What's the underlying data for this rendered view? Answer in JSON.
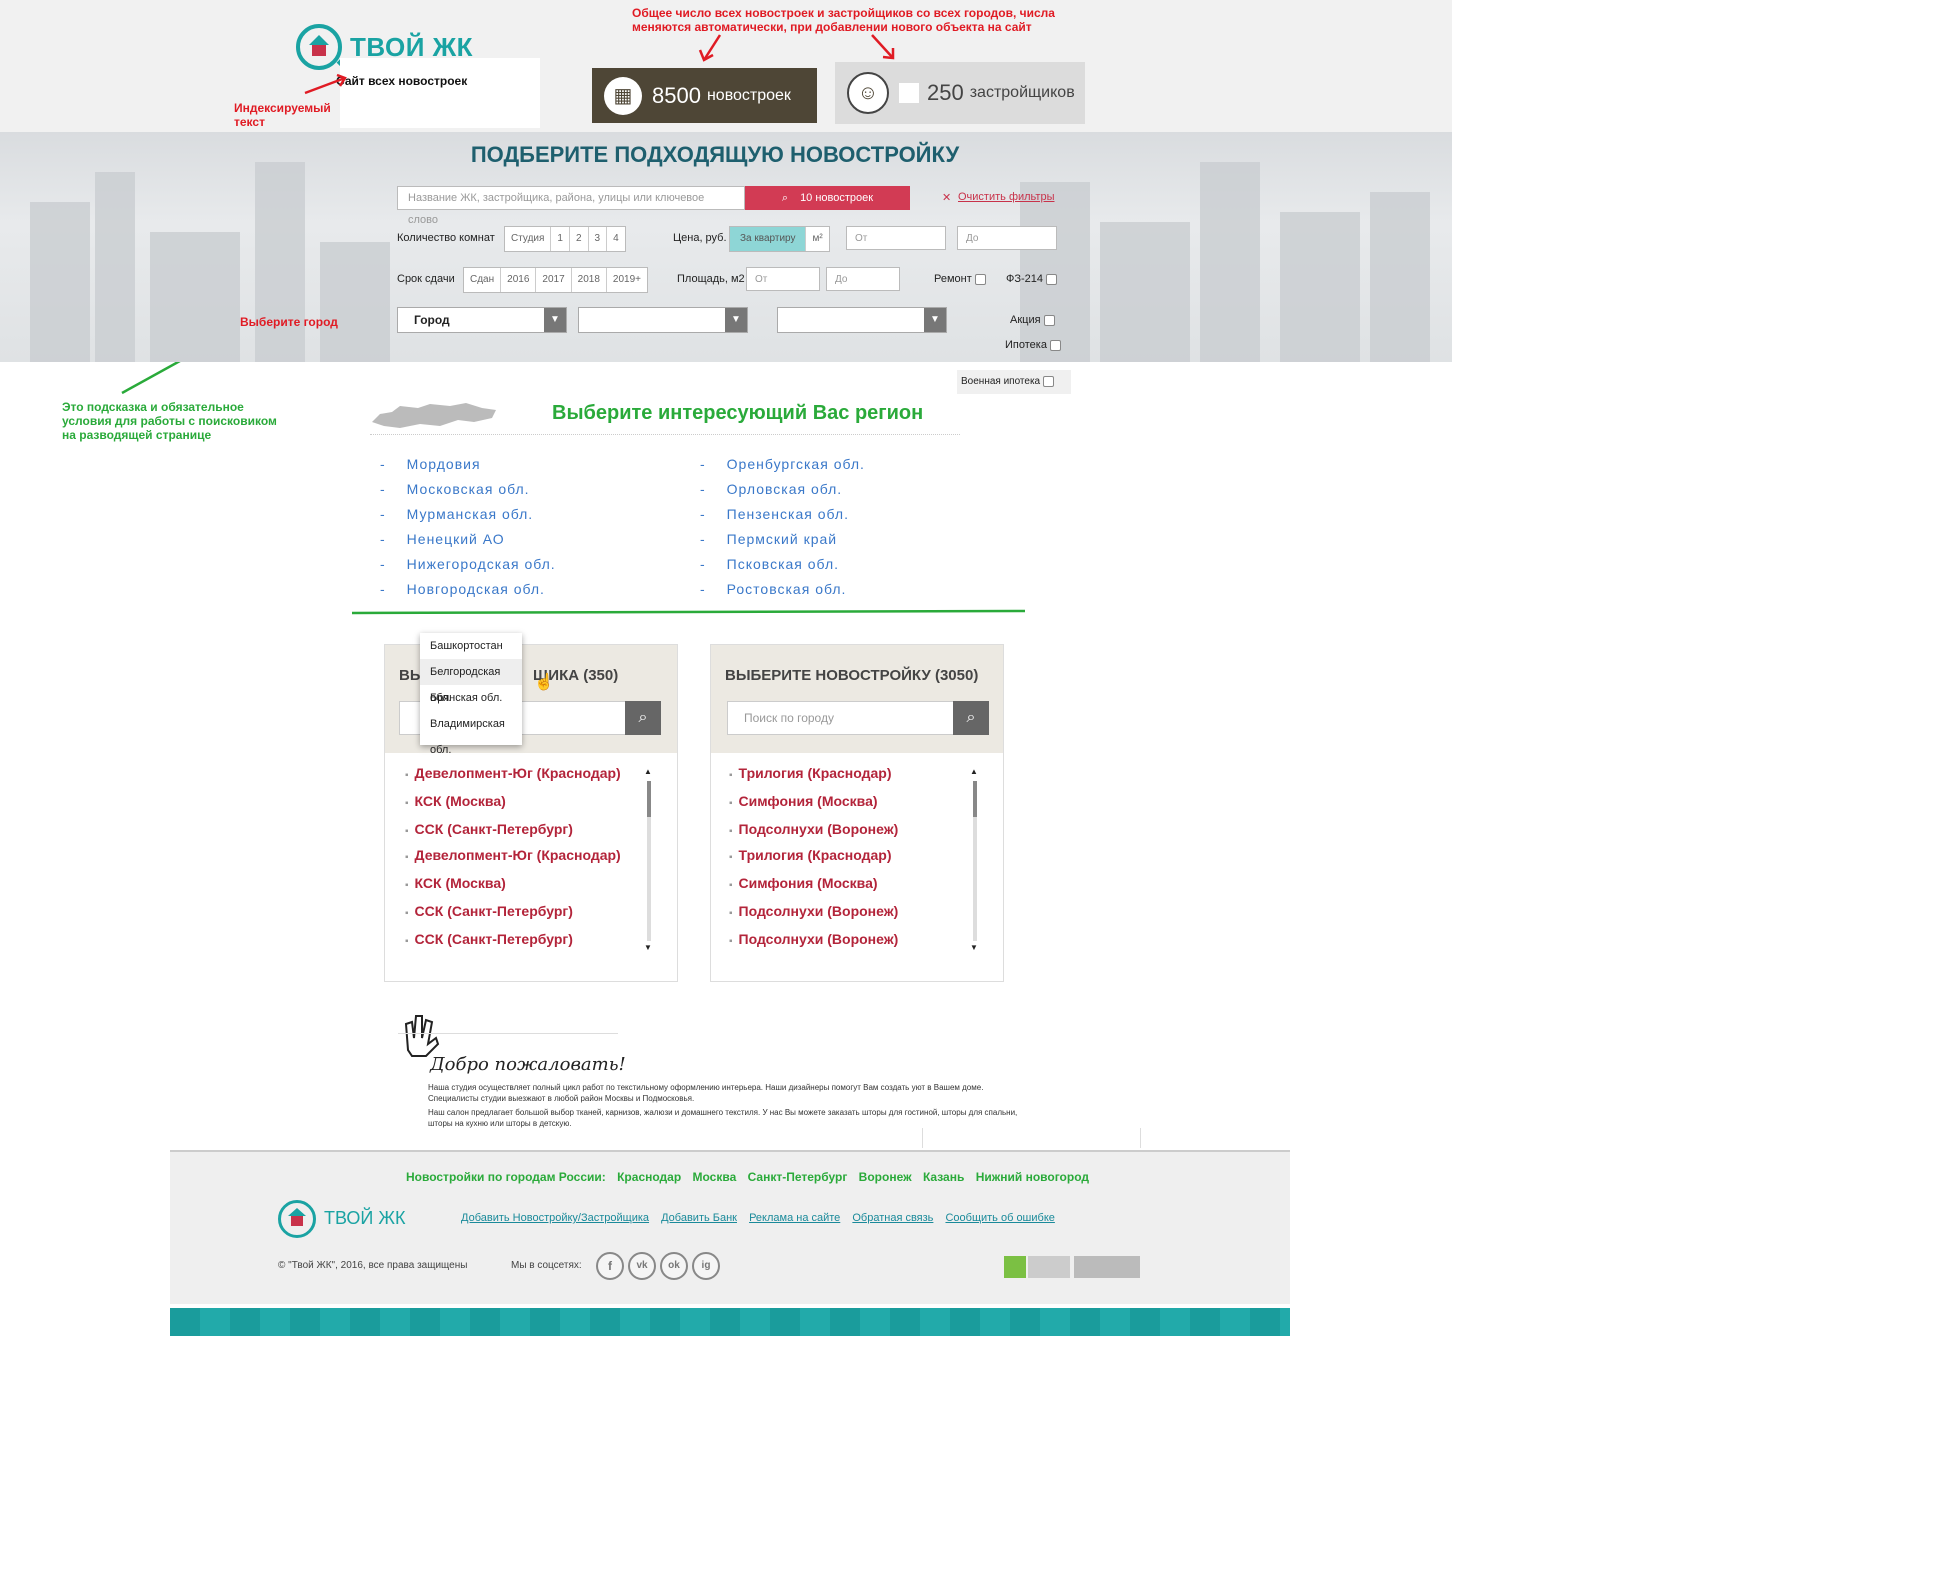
{
  "header": {
    "logo_text": "ТВОЙ ЖК",
    "tagline": "Сайт всех новостроек",
    "stats": [
      {
        "number": "8500",
        "label": "новостроек"
      },
      {
        "number": "250",
        "label": "застройщиков"
      }
    ]
  },
  "annotations": {
    "top_note": "Общее число всех новостроек и застройщиков со всех городов, числа меняются автоматически, при добавлении нового объекта на сайт",
    "indexed_text": "Индексируемый текст",
    "choose_city": "Выберите город",
    "hint": "Это подсказка и обязательное условия для работы с поисковиком на разводящей странице"
  },
  "filters": {
    "title": "ПОДБЕРИТЕ ПОДХОДЯЩУЮ НОВОСТРОЙКУ",
    "search_placeholder": "Название ЖК, застройщика, района, улицы или ключевое слово",
    "search_button": "10 новостроек",
    "clear": "Очистить фильтры",
    "rooms_label": "Количество комнат",
    "rooms": [
      "Студия",
      "1",
      "2",
      "3",
      "4"
    ],
    "price_label": "Цена, руб.",
    "price_modes": [
      "За квартиру",
      "м²"
    ],
    "from": "От",
    "to": "До",
    "deadline_label": "Срок сдачи",
    "deadlines": [
      "Сдан",
      "2016",
      "2017",
      "2018",
      "2019+"
    ],
    "area_label": "Площадь, м2",
    "repair": "Ремонт",
    "fz": "ФЗ-214",
    "action": "Акция",
    "mortgage": "Ипотека",
    "military": "Военная ипотека",
    "city_select": "Город"
  },
  "regions": {
    "title": "Выберите интересующий Вас регион",
    "left": [
      "Мордовия",
      "Московская обл.",
      "Мурманская обл.",
      "Ненецкий АО",
      "Нижегородская обл.",
      "Новгородская обл."
    ],
    "right": [
      "Оренбургская обл.",
      "Орловская обл.",
      "Пензенская обл.",
      "Пермский край",
      "Псковская обл.",
      "Ростовская обл."
    ]
  },
  "developers_panel": {
    "title": "ВЫБЕРИТЕ ЗАСТРОЙЩИКА (350)",
    "title_visible": "ЩИКА (350)",
    "title_prefix": "ВЫ",
    "items": [
      "Девелопмент-Юг (Краснодар)",
      "КСК (Москва)",
      "ССК (Санкт-Петербург)",
      "Девелопмент-Юг (Краснодар)",
      "КСК (Москва)",
      "ССК (Санкт-Петербург)",
      "ССК (Санкт-Петербург)"
    ]
  },
  "dropdown": [
    "Башкортостан",
    "Белгородская обл.",
    "Брянская обл.",
    "Владимирская обл."
  ],
  "buildings_panel": {
    "title": "ВЫБЕРИТЕ НОВОСТРОЙКУ (3050)",
    "search_placeholder": "Поиск по городу",
    "items": [
      "Трилогия (Краснодар)",
      "Симфония (Москва)",
      "Подсолнухи (Воронеж)",
      "Трилогия (Краснодар)",
      "Симфония (Москва)",
      "Подсолнухи (Воронеж)",
      "Подсолнухи (Воронеж)"
    ]
  },
  "welcome": {
    "title": "Добро пожаловать!",
    "p1": "Наша студия осуществляет полный цикл работ по текстильному оформлению интерьера. Наши дизайнеры помогут Вам создать уют в Вашем доме.",
    "p2": "Специалисты студии выезжают в любой район Москвы и Подмосковья.",
    "p3": "Наш салон предлагает большой выбор тканей, карнизов, жалюзи и домашнего текстиля. У нас Вы можете заказать шторы для гостиной, шторы для спальни,",
    "p4": "шторы на кухню или шторы в детскую."
  },
  "footer": {
    "cities_label": "Новостройки по городам России:",
    "cities": [
      "Краснодар",
      "Москва",
      "Санкт-Петербург",
      "Воронеж",
      "Казань",
      "Нижний новогород"
    ],
    "logo_text": "ТВОЙ ЖК",
    "links": [
      "Добавить Новостройку/Застройщика",
      "Добавить Банк",
      "Реклама на сайте",
      "Обратная связь",
      "Сообщить об ошибке"
    ],
    "copyright": "© \"Твой ЖК\", 2016, все права защищены",
    "social_label": "Мы в соцсетях:",
    "social": [
      "f",
      "vk",
      "ok",
      "ig"
    ]
  },
  "colors": {
    "teal": "#1aa3a3",
    "accent_red": "#d23b54",
    "annotation_red": "#e01b24",
    "annotation_green": "#2aaa3a"
  }
}
